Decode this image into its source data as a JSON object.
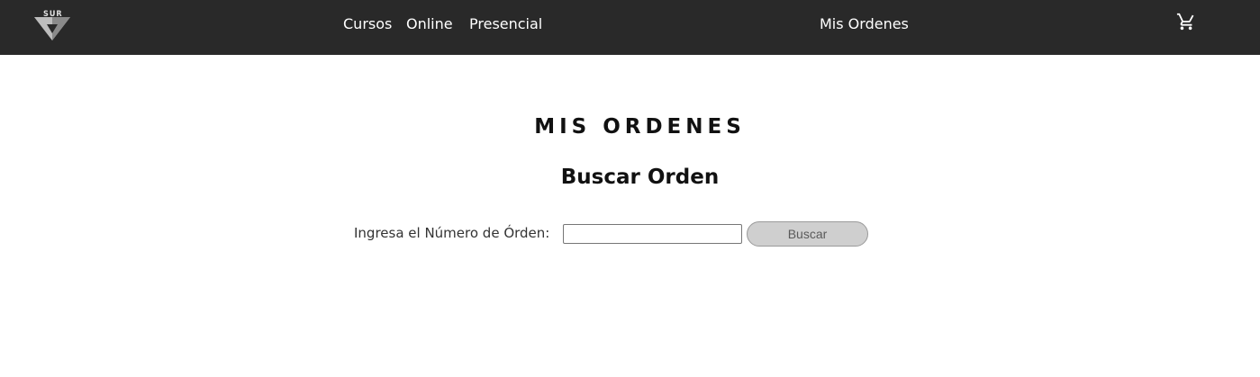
{
  "navbar": {
    "logo_text": "SUR",
    "links": {
      "cursos": "Cursos",
      "online": "Online",
      "presencial": "Presencial",
      "mis_ordenes": "Mis Ordenes"
    },
    "cart_icon": "shopping-cart-icon",
    "background_color": "#292929"
  },
  "main": {
    "title": "MIS ORDENES",
    "subtitle": "Buscar Orden",
    "search": {
      "label": "Ingresa el Número de Órden:",
      "input_value": "",
      "button_label": "Buscar"
    }
  }
}
